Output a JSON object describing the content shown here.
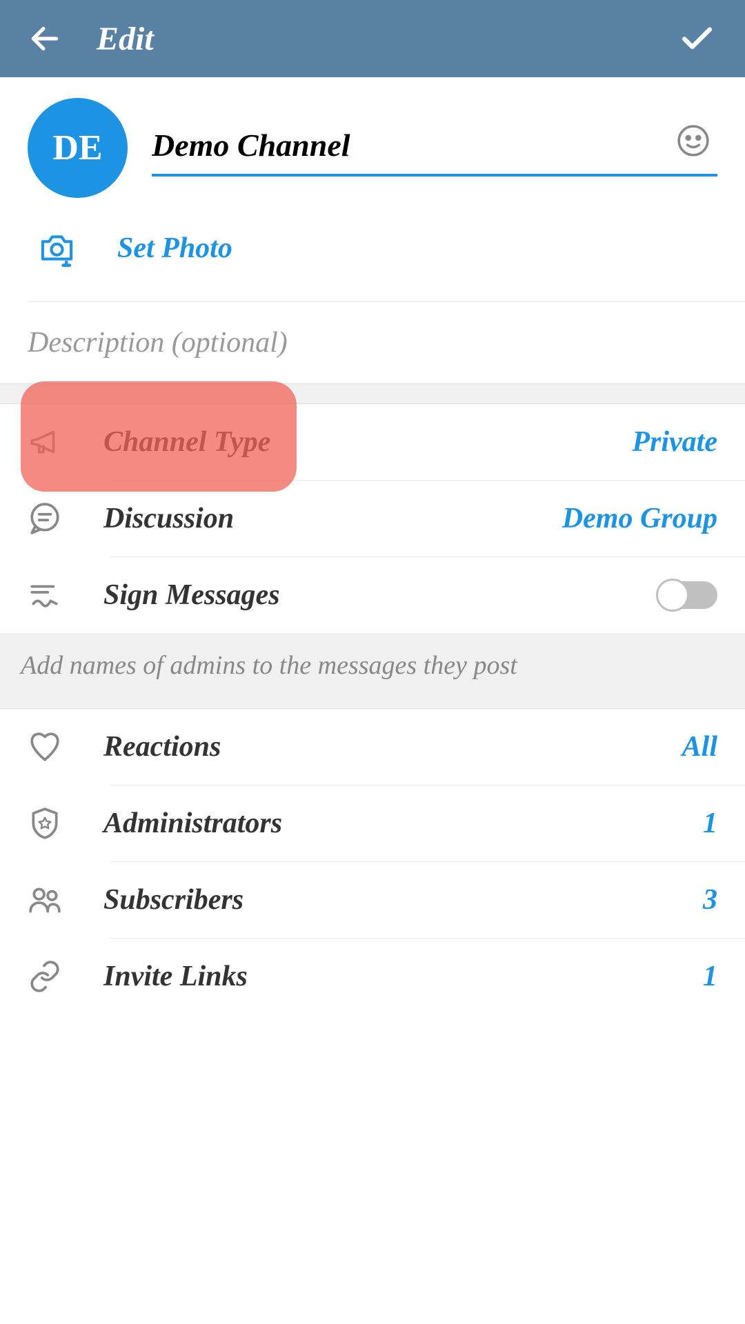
{
  "header": {
    "title": "Edit"
  },
  "profile": {
    "avatar_initials": "DE",
    "name": "Demo Channel",
    "set_photo_label": "Set Photo",
    "description_placeholder": "Description (optional)"
  },
  "settings": {
    "channel_type": {
      "label": "Channel Type",
      "value": "Private"
    },
    "discussion": {
      "label": "Discussion",
      "value": "Demo Group"
    },
    "sign_messages": {
      "label": "Sign Messages"
    },
    "sign_messages_footer": "Add names of admins to the messages they post",
    "reactions": {
      "label": "Reactions",
      "value": "All"
    },
    "administrators": {
      "label": "Administrators",
      "value": "1"
    },
    "subscribers": {
      "label": "Subscribers",
      "value": "3"
    },
    "invite_links": {
      "label": "Invite Links",
      "value": "1"
    }
  }
}
